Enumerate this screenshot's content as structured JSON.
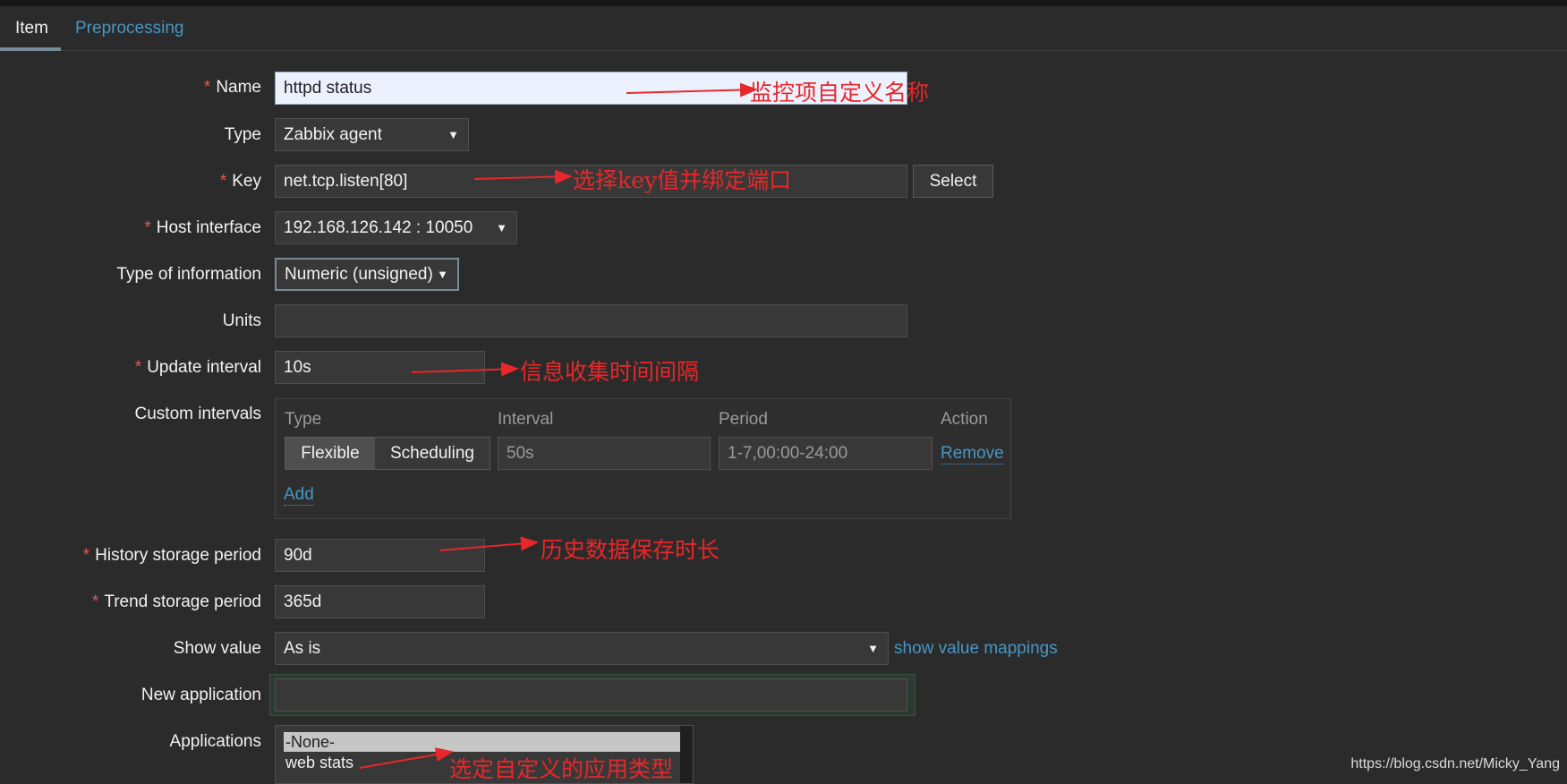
{
  "tabs": [
    "Item",
    "Preprocessing"
  ],
  "form": {
    "name": {
      "label": "Name",
      "value": "httpd status"
    },
    "type": {
      "label": "Type",
      "value": "Zabbix agent"
    },
    "key": {
      "label": "Key",
      "value": "net.tcp.listen[80]",
      "button": "Select"
    },
    "host_interface": {
      "label": "Host interface",
      "value": "192.168.126.142 : 10050"
    },
    "type_of_information": {
      "label": "Type of information",
      "value": "Numeric (unsigned)"
    },
    "units": {
      "label": "Units",
      "value": ""
    },
    "update_interval": {
      "label": "Update interval",
      "value": "10s"
    },
    "custom_intervals": {
      "label": "Custom intervals",
      "headers": [
        "Type",
        "Interval",
        "Period",
        "Action"
      ],
      "row": {
        "type_active": "Flexible",
        "type_other": "Scheduling",
        "interval": "50s",
        "period": "1-7,00:00-24:00",
        "action": "Remove"
      },
      "add": "Add"
    },
    "history": {
      "label": "History storage period",
      "value": "90d"
    },
    "trend": {
      "label": "Trend storage period",
      "value": "365d"
    },
    "show_value": {
      "label": "Show value",
      "value": "As is",
      "link": "show value mappings"
    },
    "new_application": {
      "label": "New application",
      "value": ""
    },
    "applications": {
      "label": "Applications",
      "options": [
        "-None-",
        "web stats"
      ]
    }
  },
  "annotations": {
    "name": "监控项自定义名称",
    "key": "选择key值并绑定端口",
    "update": "信息收集时间间隔",
    "history": "历史数据保存时长",
    "apps": "选定自定义的应用类型"
  },
  "watermark": "https://blog.csdn.net/Micky_Yang",
  "colors": {
    "background": "#2b2b2b",
    "link": "#4796c4",
    "required": "#e45959",
    "annotation": "#e8272b"
  }
}
